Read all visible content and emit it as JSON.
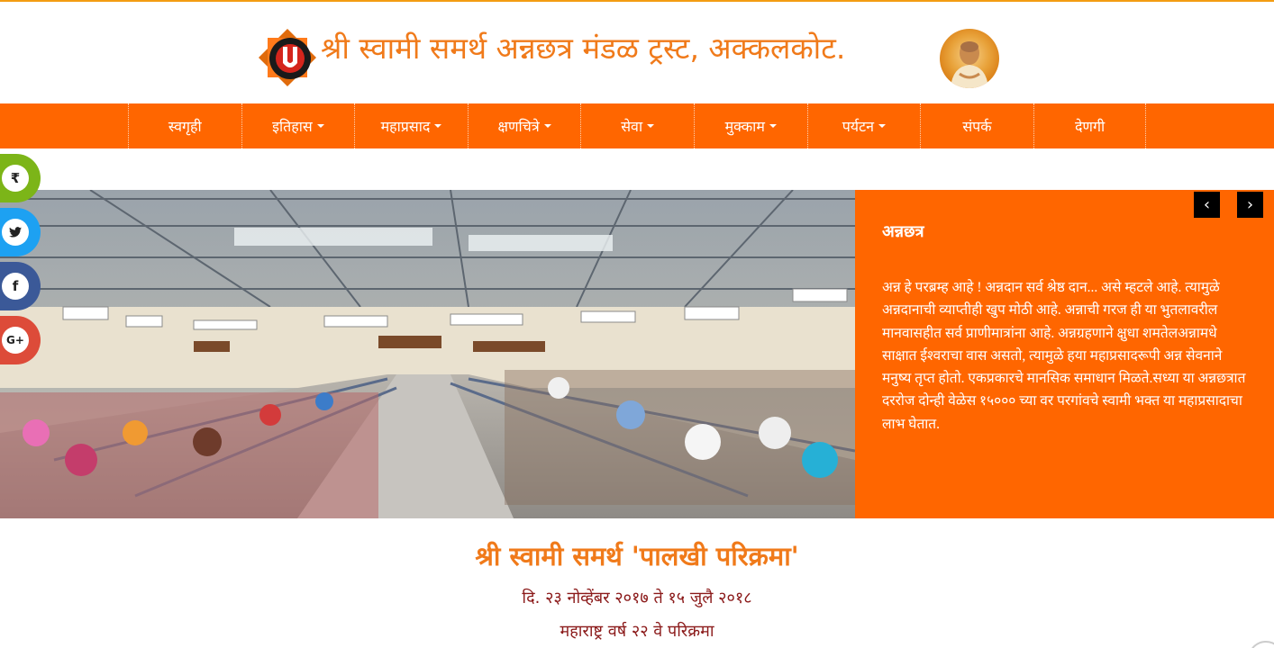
{
  "header": {
    "site_title": "श्री स्वामी समर्थ अन्नछत्र मंडळ ट्रस्ट, अक्कलकोट.",
    "logo_icon": "trust-logo-icon",
    "avatar_icon": "swami-portrait"
  },
  "nav": {
    "items": [
      {
        "label": "स्वगृही",
        "dropdown": false
      },
      {
        "label": "इतिहास",
        "dropdown": true
      },
      {
        "label": "महाप्रसाद",
        "dropdown": true
      },
      {
        "label": "क्षणचित्रे",
        "dropdown": true
      },
      {
        "label": "सेवा",
        "dropdown": true
      },
      {
        "label": "मुक्काम",
        "dropdown": true
      },
      {
        "label": "पर्यटन",
        "dropdown": true
      },
      {
        "label": "संपर्क",
        "dropdown": false
      },
      {
        "label": "देणगी",
        "dropdown": false
      }
    ]
  },
  "social": {
    "rupee": "₹",
    "twitter": "🐦",
    "facebook": "f",
    "gplus": "G+"
  },
  "slider": {
    "title": "अन्नछत्र",
    "text": "अन्न हे परब्रम्ह आहे ! अन्नदान सर्व श्रेष्ठ दान... असे म्हटले आहे. त्यामुळे अन्नदानाची व्याप्तीही खुप मोठी आहे. अन्नाची गरज ही या भुतलावरील मानवासहीत सर्व प्राणीमात्रांना आहे. अन्नग्रहणाने क्षुधा शमतेलअन्नामधे साक्षात ईश्वराचा वास असतो, त्यामुळे हया महाप्रसादरूपी अन्न सेवनाने मनुष्य तृप्त होतो. एकप्रकारचे मानसिक समाधान मिळते.सध्या या अन्नछत्रात दररोज दोन्ही वेळेस १५००० च्या वर परगांवचे स्वामी भक्त या महाप्रसादाचा लाभ घेतात.",
    "prev_arrow": "‹",
    "next_arrow": "›"
  },
  "content": {
    "headline": "श्री स्वामी समर्थ 'पालखी परिक्रमा'",
    "date_line": "दि. २३ नोव्हेंबर २०१७ ते १५ जुलै २०१८",
    "year_line": "महाराष्ट्र वर्ष २२ वे परिक्रमा"
  },
  "colors": {
    "brand_orange": "#ff6600",
    "title_orange": "#f07a1a",
    "dark_red": "#8b1a1a"
  }
}
